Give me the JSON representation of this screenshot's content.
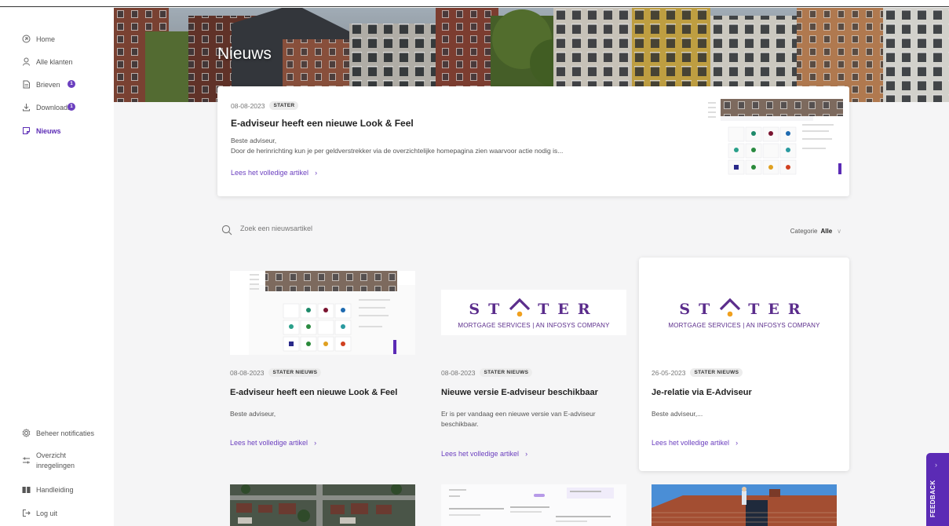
{
  "sidebar": {
    "items": [
      {
        "label": "Home",
        "icon": "home-icon"
      },
      {
        "label": "Alle klanten",
        "icon": "user-icon"
      },
      {
        "label": "Brieven",
        "icon": "document-icon",
        "badge": "1"
      },
      {
        "label": "Downloads",
        "icon": "download-icon",
        "badge": "1"
      },
      {
        "label": "Nieuws",
        "icon": "news-icon",
        "active": true
      }
    ],
    "bottom_items": [
      {
        "label": "Beheer notificaties",
        "icon": "gear-icon"
      },
      {
        "label": "Overzicht instellingen",
        "line1": "Overzicht",
        "line2": "inregelingen",
        "icon": "sliders-icon"
      },
      {
        "label": "Handleiding",
        "icon": "book-icon"
      },
      {
        "label": "Log uit",
        "icon": "logout-icon"
      }
    ]
  },
  "page": {
    "title": "Nieuws"
  },
  "featured": {
    "date": "08-08-2023",
    "tag": "STATER",
    "title": "E-adviseur heeft een nieuwe Look & Feel",
    "body_line1": "Beste adviseur,",
    "body_line2": "Door de herinrichting kun je per geldverstrekker via de overzichtelijke homepagina zien waarvoor actie nodig is...",
    "read_more": "Lees het volledige artikel"
  },
  "search": {
    "placeholder": "Zoek een nieuwsartikel",
    "category_label": "Categorie",
    "category_value": "Alle"
  },
  "cards": [
    {
      "date": "08-08-2023",
      "tag": "STATER NIEUWS",
      "title": "E-adviseur heeft een nieuwe Look & Feel",
      "body": "Beste adviseur,",
      "read_more": "Lees het volledige artikel"
    },
    {
      "date": "08-08-2023",
      "tag": "STATER NIEUWS",
      "title": "Nieuwe versie E-adviseur beschikbaar",
      "body": "Er is per vandaag een nieuwe versie van E-adviseur beschikbaar.",
      "read_more": "Lees het volledige artikel"
    },
    {
      "date": "26-05-2023",
      "tag": "STATER NIEUWS",
      "title": "Je-relatie via E-Adviseur",
      "body": "Beste adviseur,...",
      "read_more": "Lees het volledige artikel"
    }
  ],
  "logo": {
    "word_left": "ST",
    "word_right": "TER",
    "subtitle": "MORTGAGE SERVICES | AN INFOSYS COMPANY"
  },
  "feedback": {
    "label": "FEEDBACK"
  },
  "colors": {
    "accent": "#6b3fbf",
    "brand_purple": "#5b2d8c",
    "logo_dot": "#f0a01e"
  }
}
